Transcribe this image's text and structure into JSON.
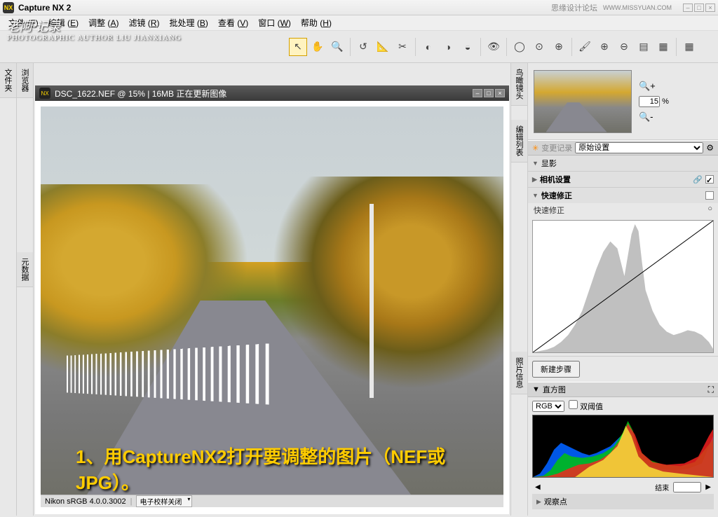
{
  "titlebar": {
    "app_name": "Capture NX 2",
    "watermark": "思缘设计论坛",
    "watermark_url": "WWW.MISSYUAN.COM"
  },
  "menu": {
    "file": "文件",
    "file_k": "F",
    "edit": "编辑",
    "edit_k": "E",
    "adjust": "调整",
    "adjust_k": "A",
    "filter": "滤镜",
    "filter_k": "R",
    "batch": "批处理",
    "batch_k": "B",
    "view": "查看",
    "view_k": "V",
    "window": "窗口",
    "window_k": "W",
    "help": "帮助",
    "help_k": "H"
  },
  "overlay": {
    "line1": "老阿·记录",
    "line2": "PHOTOGRAPHIC AUTHOR LIU JIANXIANG"
  },
  "left_tabs": {
    "folder": "文件夹",
    "browser": "浏览器",
    "metadata": "元数据"
  },
  "doc": {
    "title": "DSC_1622.NEF @ 15% | 16MB 正在更新图像",
    "status_profile": "Nikon sRGB 4.0.0.3002",
    "status_proof": "电子校样关闭"
  },
  "caption": "1、用CaptureNX2打开要调整的图片（NEF或JPG）。",
  "right_tabs": {
    "birdseye": "鸟瞰镜头",
    "editlist": "编辑列表",
    "photoinfo": "照片信息"
  },
  "zoom": {
    "value": "15",
    "percent": "%"
  },
  "edit": {
    "history_label": "变更记录",
    "preset": "原始设置",
    "section_develop": "显影",
    "section_camera": "相机设置",
    "section_quickfix": "快速修正",
    "quickfix_label": "快速修正",
    "new_step": "新建步骤"
  },
  "hist": {
    "title": "直方图",
    "channel": "RGB",
    "threshold": "双阈值",
    "watch": "观察点",
    "apply": "结束"
  }
}
